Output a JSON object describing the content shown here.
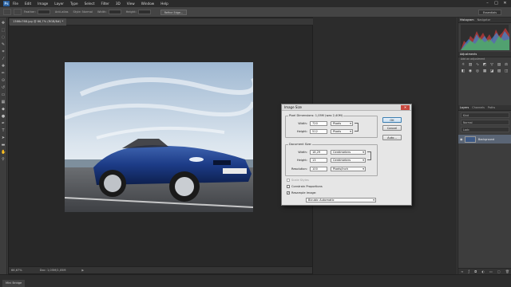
{
  "menu": {
    "logo": "Ps",
    "items": [
      "File",
      "Edit",
      "Image",
      "Layer",
      "Type",
      "Select",
      "Filter",
      "3D",
      "View",
      "Window",
      "Help"
    ],
    "window_controls": [
      "–",
      "□",
      "✕"
    ]
  },
  "options_bar": {
    "feather_label": "Feather:",
    "antialias_label": "Anti-alias",
    "style_label": "Style:",
    "style_value": "Normal",
    "width_label": "Width:",
    "height_label": "Height:",
    "refine_edge": "Refine Edge...",
    "workspace": "Essentials"
  },
  "document": {
    "tab_title": "1366x768.jpg @ 66,7% (RGB/8#) *",
    "zoom": "66,67%",
    "doc_size": "Doc: 1,05M/1,05M"
  },
  "right_panel": {
    "top_tabs": [
      "Histogram",
      "Navigator"
    ],
    "adjustments_tab": "Adjustments",
    "adjustments_hint": "Add an adjustment",
    "layer_tabs": [
      "Layers",
      "Channels",
      "Paths"
    ],
    "kind_label": "Kind",
    "mode_label": "Normal",
    "lock_label": "Lock:",
    "layer_name": "Background"
  },
  "bottom_bar": {
    "mini_bridge": "Mini Bridge"
  },
  "dialog": {
    "title": "Image Size",
    "pixel_dimensions_label": "Pixel Dimensions:",
    "pixel_dimensions_value": "1,05M (was 2,40M)",
    "pixel_width_label": "Width:",
    "pixel_width_value": "720",
    "pixel_width_unit": "Pixels",
    "pixel_height_label": "Height:",
    "pixel_height_value": "512",
    "pixel_height_unit": "Pixels",
    "document_size_label": "Document Size:",
    "doc_width_label": "Width:",
    "doc_width_value": "18,29",
    "doc_width_unit": "Centimeters",
    "doc_height_label": "Height:",
    "doc_height_value": "13",
    "doc_height_unit": "Centimeters",
    "resolution_label": "Resolution:",
    "resolution_value": "100",
    "resolution_unit": "Pixels/Inch",
    "scale_styles": "Scale Styles",
    "constrain_proportions": "Constrain Proportions",
    "resample_image": "Resample Image:",
    "resample_method": "Bicubic Automatic",
    "ok": "OK",
    "cancel": "Cancel",
    "auto": "Auto...",
    "close": "✕",
    "resample_checked": "✓"
  }
}
